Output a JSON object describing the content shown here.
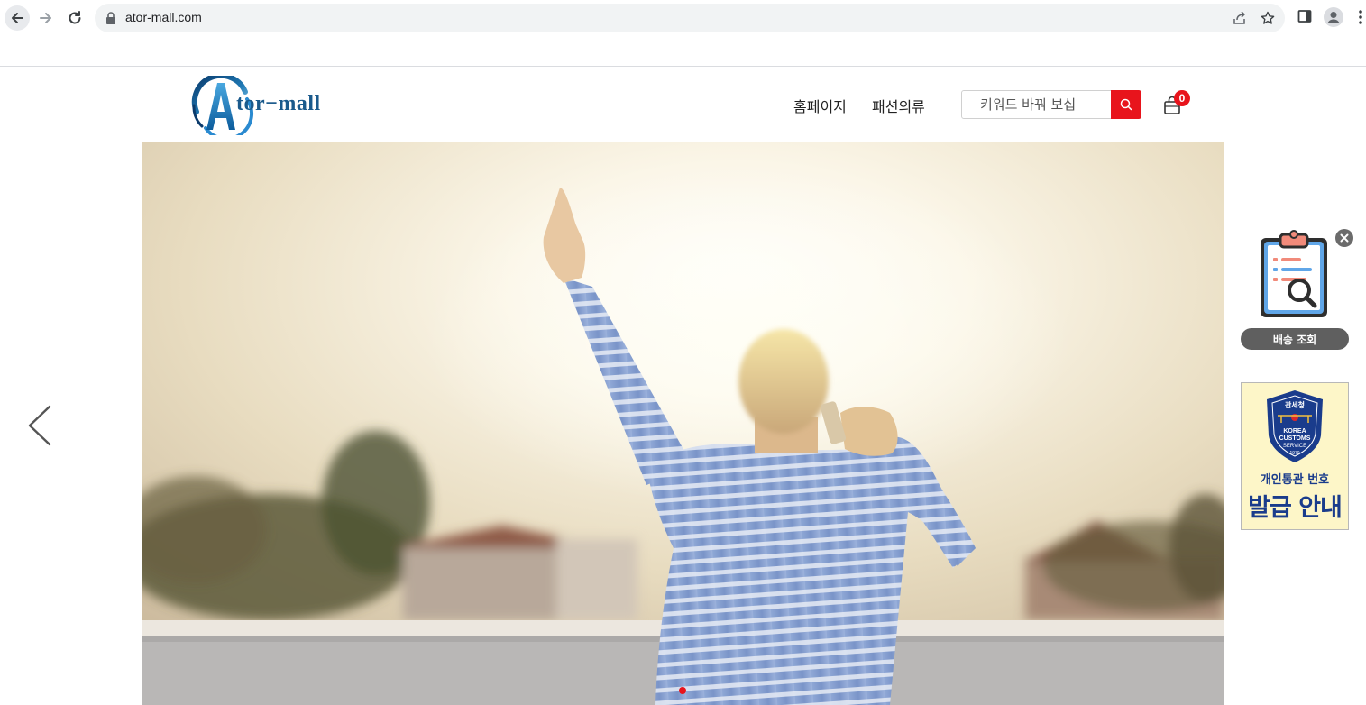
{
  "browser": {
    "url": "ator-mall.com"
  },
  "header": {
    "logo_text": "tor−mall",
    "nav": [
      "홈페이지",
      "패션의류"
    ],
    "search_placeholder": "키워드 바꿔 보십",
    "cart_count": "0"
  },
  "widgets": {
    "delivery_label": "배송 조회",
    "customs_seal_top": "관세청",
    "customs_seal_korea": "KOREA",
    "customs_seal_customs": "CUSTOMS",
    "customs_seal_service": "SERVICE",
    "customs_seal_year": "1970",
    "customs_line1": "개인통관 번호",
    "customs_line2": "발급 안내"
  },
  "hero": {
    "active_slide": 1
  },
  "colors": {
    "accent": "#e8141c",
    "logo_blue": "#1a5a8c",
    "customs_blue": "#1a3c8c",
    "customs_bg": "#fdf6c8"
  }
}
